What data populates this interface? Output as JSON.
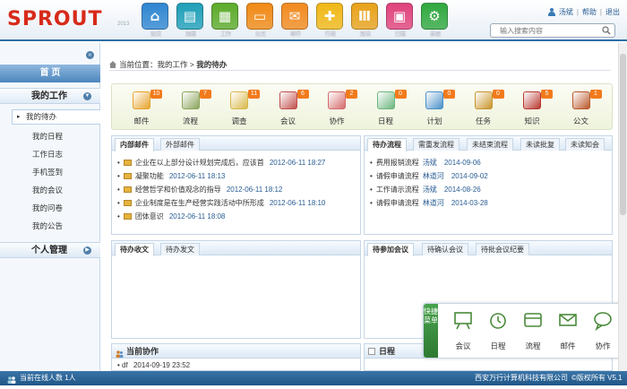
{
  "header": {
    "logo": "SPROUT",
    "logo_sub": "2013",
    "nav": [
      {
        "label": "首页",
        "icon": "home-icon",
        "color": "#2f86d1"
      },
      {
        "label": "流程",
        "icon": "book-icon",
        "color": "#1f9fb8"
      },
      {
        "label": "工作",
        "icon": "grid-icon",
        "color": "#5cab2a"
      },
      {
        "label": "公文",
        "icon": "briefcase-icon",
        "color": "#f08a16"
      },
      {
        "label": "邮件",
        "icon": "mail-icon",
        "color": "#f28a1e"
      },
      {
        "label": "行政",
        "icon": "puzzle-icon",
        "color": "#f0b817"
      },
      {
        "label": "知识",
        "icon": "books-icon",
        "color": "#e8a21a"
      },
      {
        "label": "日程",
        "icon": "calendar-icon",
        "color": "#e0437c"
      },
      {
        "label": "系统",
        "icon": "gear-icon",
        "color": "#2fa83e"
      }
    ],
    "user": "汤斌",
    "help": "帮助",
    "logout": "退出",
    "search_placeholder": "输入搜索内容"
  },
  "sidebar": {
    "home": "首 页",
    "my_work": "我的工作",
    "items": [
      "我的待办",
      "我的日程",
      "工作日志",
      "手机签到",
      "我的会议",
      "我的问卷",
      "我的公告"
    ],
    "personal": "个人管理",
    "collapse_icon": "double-chevron-left-icon"
  },
  "breadcrumb": {
    "prefix": "当前位置：",
    "parent": "我的工作",
    "sep": " > ",
    "current": "我的待办"
  },
  "tiles": [
    {
      "label": "邮件",
      "badge": "10",
      "icon": "mail-icon",
      "color": "#e6a22b"
    },
    {
      "label": "流程",
      "badge": "7",
      "icon": "clipboard-icon",
      "color": "#8aa35a"
    },
    {
      "label": "调查",
      "badge": "11",
      "icon": "calendar-icon",
      "color": "#d8b84a"
    },
    {
      "label": "会议",
      "badge": "6",
      "icon": "people-icon",
      "color": "#c0504d"
    },
    {
      "label": "协作",
      "badge": "2",
      "icon": "collab-icon",
      "color": "#d46b6b"
    },
    {
      "label": "日程",
      "badge": "0",
      "icon": "calendar-icon",
      "color": "#6bb57d"
    },
    {
      "label": "计划",
      "badge": "0",
      "icon": "plan-icon",
      "color": "#4a90c8"
    },
    {
      "label": "任务",
      "badge": "0",
      "icon": "task-icon",
      "color": "#c8942a"
    },
    {
      "label": "知识",
      "badge": "5",
      "icon": "books-icon",
      "color": "#b8372f"
    },
    {
      "label": "公文",
      "badge": "1",
      "icon": "briefcase-icon",
      "color": "#b8572a"
    }
  ],
  "mail_panel": {
    "tabs": [
      "内部邮件",
      "外部邮件"
    ],
    "rows": [
      {
        "title": "企业在以上部分设计规划完成后，应该首",
        "time": "2012-06-11 18:27"
      },
      {
        "title": "凝聚功能",
        "time": "2012-06-11 18:13"
      },
      {
        "title": "经营哲学和价值观念的指导",
        "time": "2012-06-11 18:12"
      },
      {
        "title": "企业制度是在生产经营实践活动中所形成",
        "time": "2012-06-11 18:10"
      },
      {
        "title": "团体意识",
        "time": "2012-06-11 18:08"
      }
    ]
  },
  "flow_panel": {
    "tabs": [
      "待办流程",
      "需重发流程",
      "未结束流程",
      "未读批复",
      "未读知会"
    ],
    "rows": [
      {
        "title": "费用报销流程",
        "sender": "汤斌",
        "time": "2014-09-06"
      },
      {
        "title": "请假申请流程",
        "sender": "林道河",
        "time": "2014-09-02"
      },
      {
        "title": "工作请示流程",
        "sender": "汤斌",
        "time": "2014-08-26"
      },
      {
        "title": "请假申请流程",
        "sender": "林道河",
        "time": "2014-03-28"
      }
    ]
  },
  "doc_panel": {
    "tabs": [
      "待办收文",
      "待办发文"
    ]
  },
  "meeting_panel": {
    "tabs": [
      "待参加会议",
      "待确认会议",
      "待批会议纪要"
    ]
  },
  "collab_panel": {
    "title": "当前协作",
    "rows": [
      {
        "title": "df",
        "time": "2014-09-19 23:52"
      }
    ]
  },
  "schedule_panel": {
    "title": "日程"
  },
  "quick_menu": {
    "tab": "快捷菜单",
    "items": [
      {
        "label": "会议",
        "icon": "board-icon"
      },
      {
        "label": "日程",
        "icon": "clock-icon"
      },
      {
        "label": "流程",
        "icon": "cards-icon"
      },
      {
        "label": "邮件",
        "icon": "mail-icon"
      },
      {
        "label": "协作",
        "icon": "chat-icon"
      }
    ]
  },
  "footer": {
    "online": "当前在线人数 1人",
    "company": "西安万行计算机科技有限公司",
    "copyright": "©版权所有 V5.1"
  }
}
